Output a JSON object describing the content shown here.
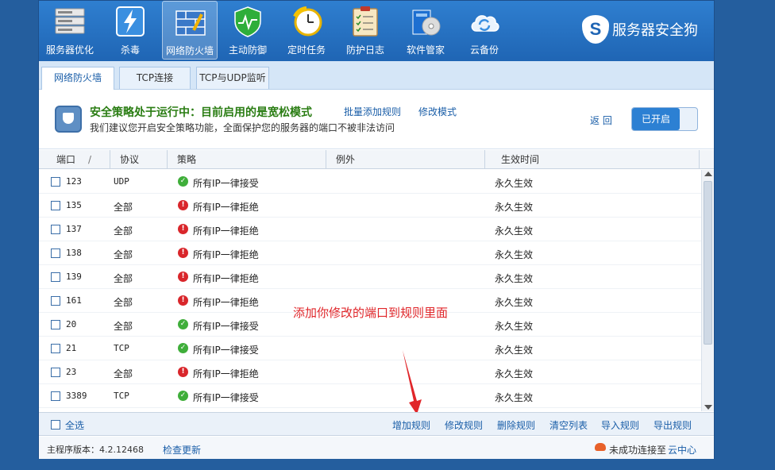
{
  "toolbar": {
    "items": [
      {
        "label": "服务器优化",
        "icon": "server-optimize-icon"
      },
      {
        "label": "杀毒",
        "icon": "antivirus-icon"
      },
      {
        "label": "网络防火墙",
        "icon": "firewall-icon"
      },
      {
        "label": "主动防御",
        "icon": "active-defense-icon"
      },
      {
        "label": "定时任务",
        "icon": "clock-icon"
      },
      {
        "label": "防护日志",
        "icon": "log-icon"
      },
      {
        "label": "软件管家",
        "icon": "software-manager-icon"
      },
      {
        "label": "云备份",
        "icon": "cloud-backup-icon"
      }
    ],
    "brand_badge": "S",
    "brand_name": "服务器安全狗"
  },
  "tabs": [
    {
      "label": "网络防火墙"
    },
    {
      "label": "TCP连接"
    },
    {
      "label": "TCP与UDP监听"
    }
  ],
  "status": {
    "title": "安全策略处于运行中：目前启用的是宽松模式",
    "desc": "我们建议您开启安全策略功能，全面保护您的服务器的端口不被非法访问",
    "batch_add": "批量添加规则",
    "edit_mode": "修改模式",
    "back": "返 回",
    "toggle": "已开启"
  },
  "table": {
    "headers": {
      "port": "端口",
      "sort": "/",
      "protocol": "协议",
      "policy": "策略",
      "exception": "例外",
      "effective": "生效时间"
    },
    "rows": [
      {
        "port": "123",
        "protocol": "UDP",
        "policy": "所有IP一律接受",
        "status": "accept",
        "effective": "永久生效"
      },
      {
        "port": "135",
        "protocol": "全部",
        "policy": "所有IP一律拒绝",
        "status": "deny",
        "effective": "永久生效"
      },
      {
        "port": "137",
        "protocol": "全部",
        "policy": "所有IP一律拒绝",
        "status": "deny",
        "effective": "永久生效"
      },
      {
        "port": "138",
        "protocol": "全部",
        "policy": "所有IP一律拒绝",
        "status": "deny",
        "effective": "永久生效"
      },
      {
        "port": "139",
        "protocol": "全部",
        "policy": "所有IP一律拒绝",
        "status": "deny",
        "effective": "永久生效"
      },
      {
        "port": "161",
        "protocol": "全部",
        "policy": "所有IP一律拒绝",
        "status": "deny",
        "effective": "永久生效"
      },
      {
        "port": "20",
        "protocol": "全部",
        "policy": "所有IP一律接受",
        "status": "accept",
        "effective": "永久生效"
      },
      {
        "port": "21",
        "protocol": "TCP",
        "policy": "所有IP一律接受",
        "status": "accept",
        "effective": "永久生效"
      },
      {
        "port": "23",
        "protocol": "全部",
        "policy": "所有IP一律拒绝",
        "status": "deny",
        "effective": "永久生效"
      },
      {
        "port": "3389",
        "protocol": "TCP",
        "policy": "所有IP一律接受",
        "status": "accept",
        "effective": "永久生效"
      }
    ]
  },
  "annotation": "添加你修改的端口到规则里面",
  "actions": {
    "select_all": "全选",
    "add": "增加规则",
    "edit": "修改规则",
    "delete": "删除规则",
    "clear": "清空列表",
    "import": "导入规则",
    "export": "导出规则"
  },
  "statusbar": {
    "version": "主程序版本：4.2.12468",
    "check_update": "检查更新",
    "connection": "未成功连接至",
    "cloud_center": "云中心"
  },
  "colors": {
    "toolbar": "#1f65b4",
    "accept": "#3fae3a",
    "deny": "#d9262b",
    "status_title": "#2a7d13",
    "link": "#1a5ea8",
    "annotation": "#e0262a"
  }
}
